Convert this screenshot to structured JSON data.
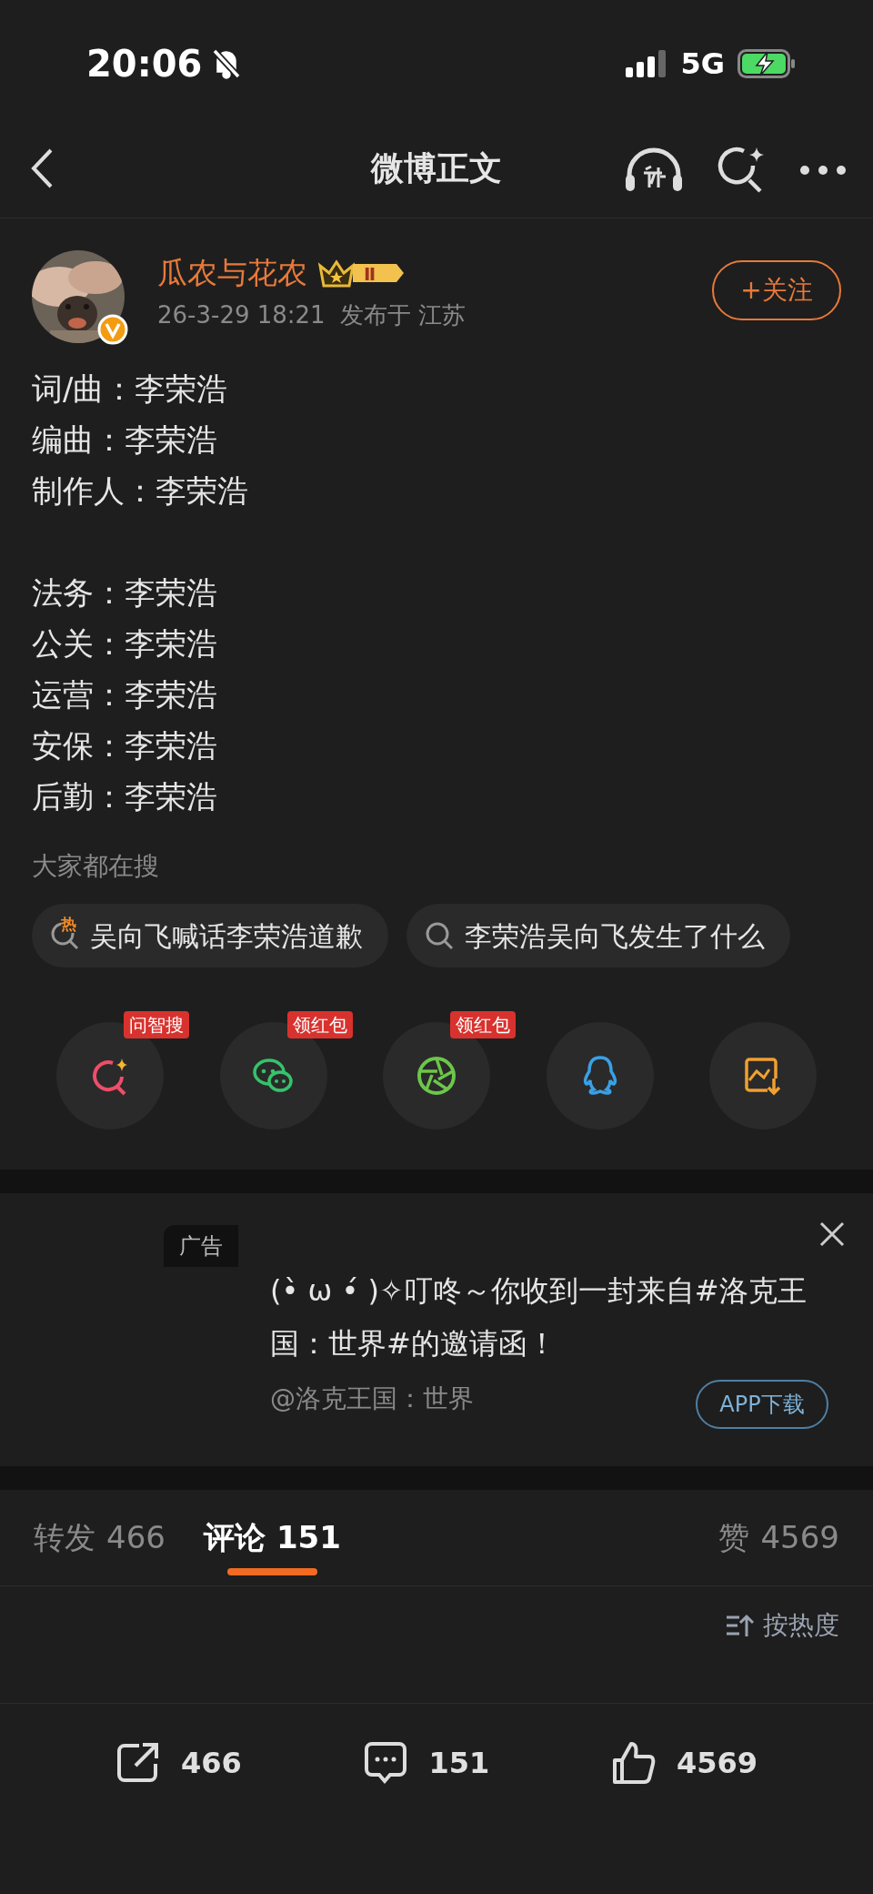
{
  "status_bar": {
    "time": "20:06",
    "network": "5G"
  },
  "nav": {
    "title": "微博正文"
  },
  "post": {
    "author": "瓜农与花农",
    "level": "Ⅱ",
    "time": "26-3-29 18:21",
    "location": "发布于 江苏",
    "follow_button": "+关注",
    "paragraphs": [
      [
        "词/曲：李荣浩",
        "编曲：李荣浩",
        "制作人：李荣浩"
      ],
      [
        "法务：李荣浩",
        "公关：李荣浩",
        "运营：李荣浩",
        "安保：李荣浩",
        "后勤：李荣浩"
      ]
    ]
  },
  "trending": {
    "title": "大家都在搜",
    "items": [
      {
        "text": "吴向飞喊话李荣浩道歉",
        "badge": "热"
      },
      {
        "text": "李荣浩吴向飞发生了什么"
      }
    ]
  },
  "share": [
    {
      "kind": "ai-search",
      "badge": "问智搜"
    },
    {
      "kind": "wechat",
      "badge": "领红包"
    },
    {
      "kind": "moments",
      "badge": "领红包"
    },
    {
      "kind": "qq"
    },
    {
      "kind": "save-image"
    }
  ],
  "ad": {
    "tag": "广告",
    "text": "(•̀ ω •́ )✧叮咚～你收到一封来自#洛克王国：世界#的邀请函！",
    "source": "@洛克王国：世界",
    "button": "APP下载"
  },
  "tabs": [
    {
      "label": "转发",
      "count": "466",
      "selected": false
    },
    {
      "label": "评论",
      "count": "151",
      "selected": true
    },
    {
      "label": "赞",
      "count": "4569",
      "selected": false
    }
  ],
  "sort": "按热度",
  "bottom_bar": [
    {
      "kind": "repost",
      "count": "466"
    },
    {
      "kind": "comment",
      "count": "151"
    },
    {
      "kind": "like",
      "count": "4569"
    }
  ]
}
